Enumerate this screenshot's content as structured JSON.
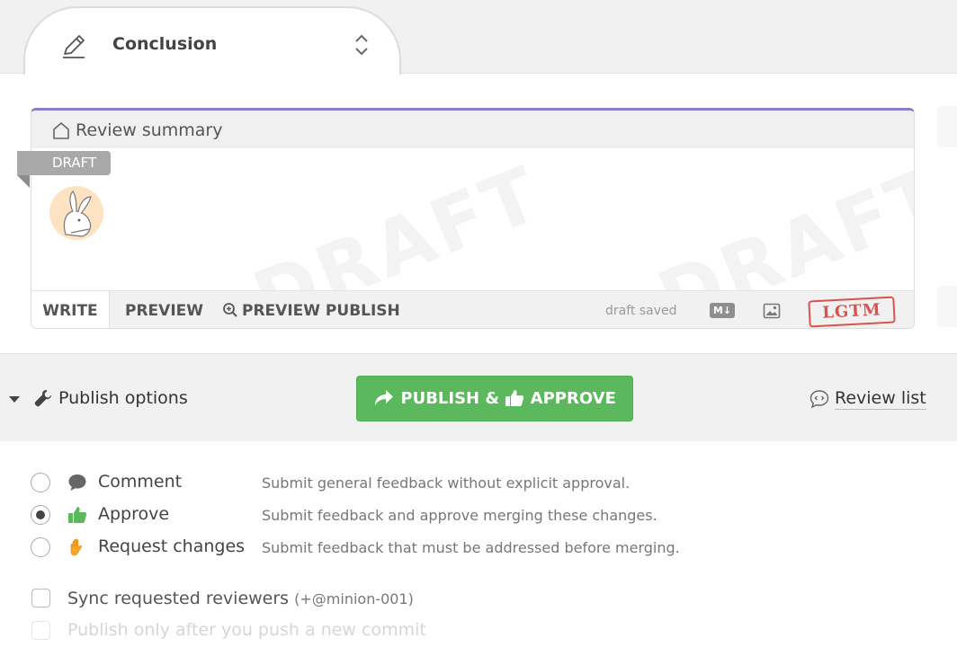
{
  "tab": {
    "title": "Conclusion"
  },
  "editor": {
    "title": "Review summary",
    "badge": "DRAFT",
    "watermark": "DRAFT",
    "tabs": {
      "write": "WRITE",
      "preview": "PREVIEW",
      "preview_publish": "PREVIEW PUBLISH"
    },
    "status": "draft saved",
    "markdown_badge": "M↓",
    "lgtm": "LGTM"
  },
  "publish": {
    "options_label": "Publish options",
    "button_part1": "PUBLISH &",
    "button_part2": "APPROVE",
    "review_list": "Review list"
  },
  "review_types": [
    {
      "label": "Comment",
      "description": "Submit general feedback without explicit approval.",
      "selected": false,
      "icon": "speech-bubble-icon"
    },
    {
      "label": "Approve",
      "description": "Submit feedback and approve merging these changes.",
      "selected": true,
      "icon": "thumbs-up-icon"
    },
    {
      "label": "Request changes",
      "description": "Submit feedback that must be addressed before merging.",
      "selected": false,
      "icon": "raised-hand-icon"
    }
  ],
  "checkboxes": {
    "sync_label": "Sync requested reviewers",
    "sync_extra": "(+@minion-001)",
    "push_label": "Publish only after you push a new commit"
  },
  "colors": {
    "accent": "#8a7cc6",
    "publish_green": "#5cb85c",
    "approve_green": "#5cb85c",
    "hand_orange": "#f5a623",
    "lgtm_red": "#d9534f"
  }
}
